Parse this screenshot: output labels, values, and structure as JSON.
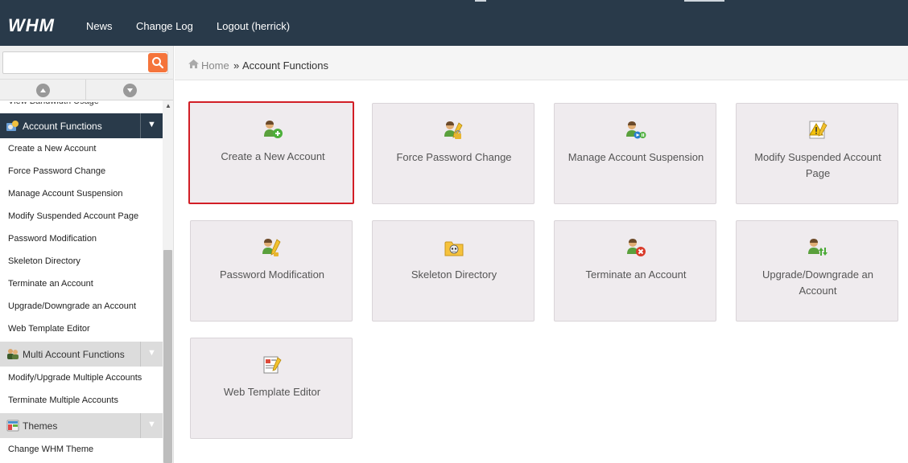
{
  "topbar": {
    "logo_text": "WHM",
    "nav": [
      {
        "label": "News"
      },
      {
        "label": "Change Log"
      },
      {
        "label": "Logout (herrick)"
      }
    ]
  },
  "sidebar": {
    "search": {
      "value": "",
      "placeholder": ""
    },
    "clipped_item": "View Bandwidth Usage",
    "sections": [
      {
        "label": "Account Functions",
        "icon": "account-functions-icon",
        "state": "expanded",
        "items": [
          "Create a New Account",
          "Force Password Change",
          "Manage Account Suspension",
          "Modify Suspended Account Page",
          "Password Modification",
          "Skeleton Directory",
          "Terminate an Account",
          "Upgrade/Downgrade an Account",
          "Web Template Editor"
        ]
      },
      {
        "label": "Multi Account Functions",
        "icon": "multi-account-icon",
        "state": "collapsed",
        "items": [
          "Modify/Upgrade Multiple Accounts",
          "Terminate Multiple Accounts"
        ]
      },
      {
        "label": "Themes",
        "icon": "themes-icon",
        "state": "collapsed",
        "items": [
          "Change WHM Theme"
        ]
      }
    ]
  },
  "breadcrumb": {
    "home": "Home",
    "separator": "»",
    "current": "Account Functions"
  },
  "tiles": [
    {
      "label": "Create a New Account",
      "icon": "user-add-icon",
      "selected": true
    },
    {
      "label": "Force Password Change",
      "icon": "user-pencil-lock-icon",
      "selected": false
    },
    {
      "label": "Manage Account Suspension",
      "icon": "user-suspend-icon",
      "selected": false
    },
    {
      "label": "Modify Suspended Account Page",
      "icon": "warning-page-icon",
      "selected": false
    },
    {
      "label": "Password Modification",
      "icon": "user-pencil-icon",
      "selected": false
    },
    {
      "label": "Skeleton Directory",
      "icon": "skull-folder-icon",
      "selected": false
    },
    {
      "label": "Terminate an Account",
      "icon": "user-remove-icon",
      "selected": false
    },
    {
      "label": "Upgrade/Downgrade an Account",
      "icon": "user-updown-icon",
      "selected": false
    },
    {
      "label": "Web Template Editor",
      "icon": "template-edit-icon",
      "selected": false
    }
  ],
  "colors": {
    "topbar": "#293a4a",
    "active_section": "#293a4a",
    "search_button": "#f5743b",
    "selected_border": "#d21e26",
    "tile_bg": "#efebee"
  }
}
